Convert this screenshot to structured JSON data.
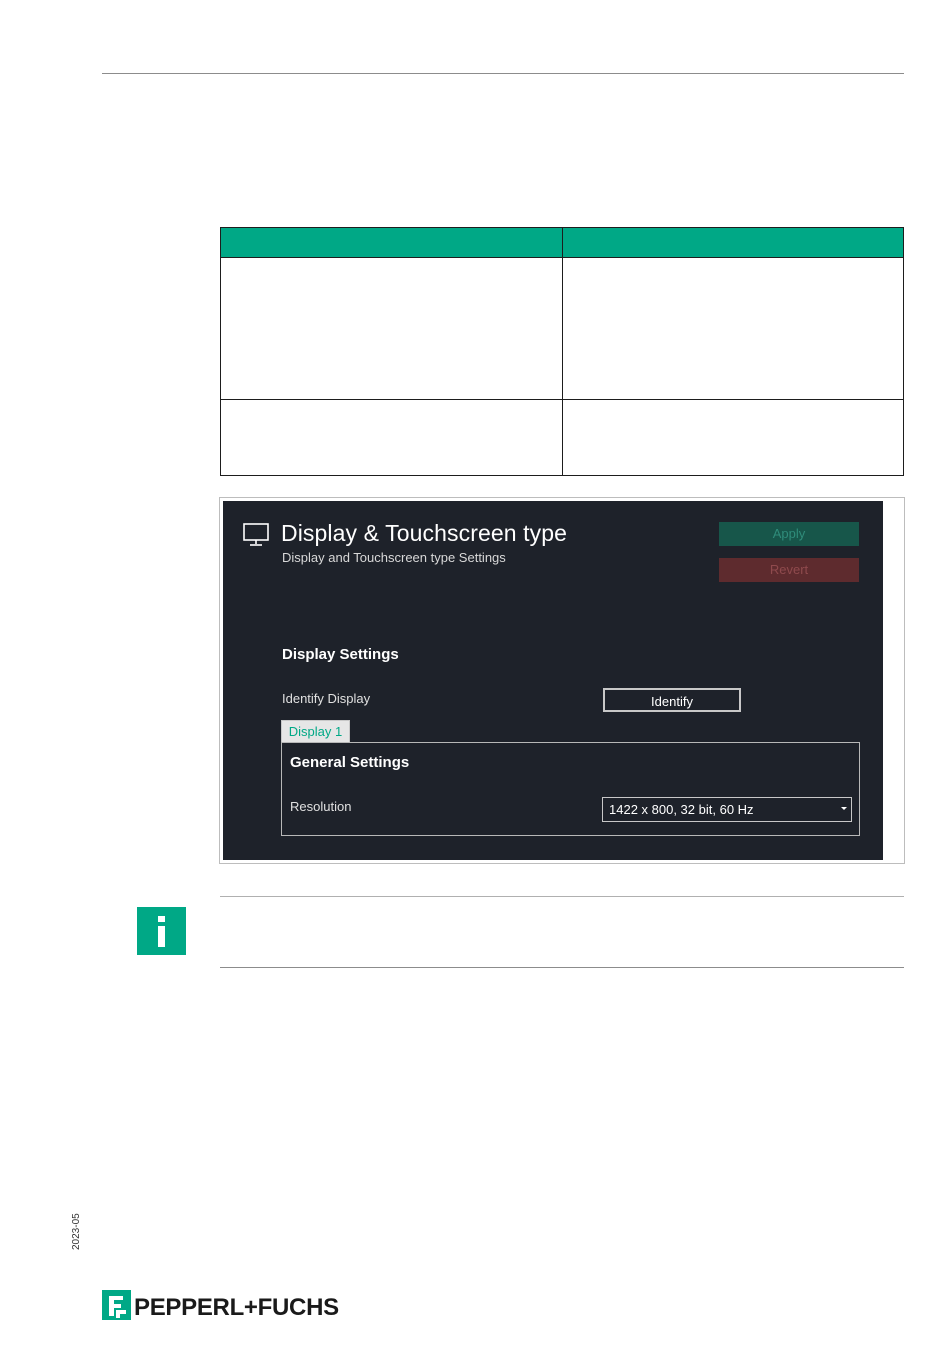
{
  "screenshot": {
    "title": "Display & Touchscreen type",
    "subtitle": "Display and Touchscreen type Settings",
    "buttons": {
      "apply_label": "Apply",
      "revert_label": "Revert"
    },
    "display_settings": {
      "heading": "Display Settings",
      "identify_label": "Identify Display",
      "identify_button": "Identify"
    },
    "tab_label": "Display 1",
    "general_settings": {
      "heading": "General Settings",
      "resolution_label": "Resolution",
      "resolution_value": "1422 x 800, 32 bit, 60 Hz"
    },
    "colors": {
      "background": "#1e222a",
      "apply": "#17564a",
      "revert": "#5e2b2e",
      "accent": "#00a886"
    }
  },
  "footer": {
    "date_code": "2023-05",
    "brand": "PEPPERL+FUCHS"
  },
  "colors": {
    "brand_green": "#00a886"
  }
}
